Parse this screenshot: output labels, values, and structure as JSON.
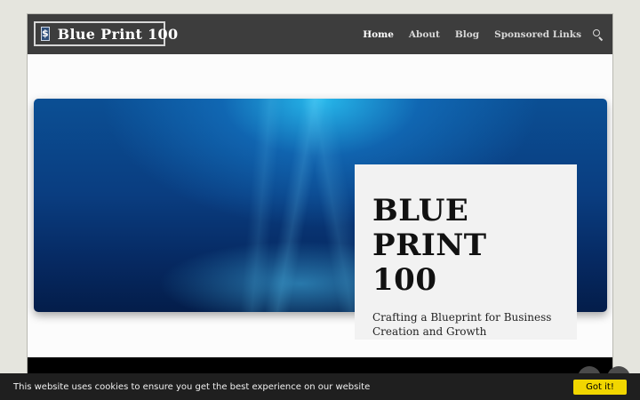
{
  "site": {
    "logo_icon": "$",
    "logo_text": "Blue Print 100"
  },
  "nav": {
    "items": [
      {
        "label": "Home",
        "active": true
      },
      {
        "label": "About",
        "active": false
      },
      {
        "label": "Blog",
        "active": false
      },
      {
        "label": "Sponsored Links",
        "active": false
      }
    ],
    "search_icon": "search-icon"
  },
  "hero": {
    "title_line1": "BLUE",
    "title_line2": "PRINT 100",
    "subtitle": "Crafting a Blueprint for Business Creation and Growth"
  },
  "cookie": {
    "message": "This website uses cookies to ensure you get the best experience on our website",
    "button": "Got it!"
  },
  "colors": {
    "header_bg": "#3d3d3d",
    "cookie_button": "#f1d600",
    "hero_blue": "#0a3d80"
  }
}
